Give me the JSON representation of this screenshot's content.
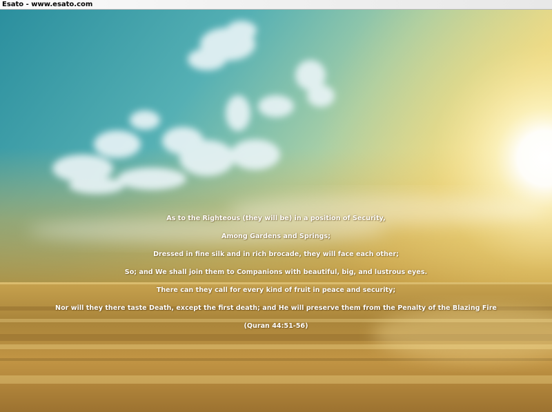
{
  "window": {
    "title": "Esato - www.esato.com"
  },
  "verses": [
    "As to the Righteous (they will be) in a position of Security,",
    "Among Gardens and Springs;",
    "Dressed in fine silk and in rich brocade, they will face each other;",
    "So; and We shall join them to Companions with beautiful, big, and lustrous eyes.",
    "There can they call for every kind of fruit in peace and security;",
    "Nor will they there taste Death, except the first death; and He will preserve them from the Penalty of the Blazing Fire"
  ],
  "citation": "(Quran 44:51-56)",
  "colors": {
    "sky_top": "#2a93a3",
    "sky_glow": "#f3dc7a",
    "sun": "#ffffff",
    "sea": "#b88a34",
    "text": "#ffffff"
  }
}
